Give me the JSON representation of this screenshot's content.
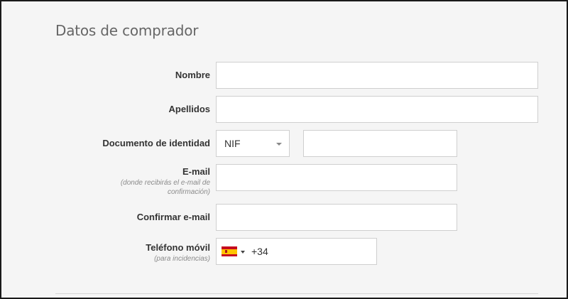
{
  "section": {
    "title": "Datos de comprador"
  },
  "fields": {
    "nombre": {
      "label": "Nombre",
      "value": ""
    },
    "apellidos": {
      "label": "Apellidos",
      "value": ""
    },
    "documento": {
      "label": "Documento de identidad",
      "type_selected": "NIF",
      "value": ""
    },
    "email": {
      "label": "E-mail",
      "hint_line1": "(donde recibirás el e-mail de",
      "hint_line2": "confirmación)",
      "value": ""
    },
    "confirmar_email": {
      "label": "Confirmar e-mail",
      "value": ""
    },
    "telefono": {
      "label": "Teléfono móvil",
      "hint": "(para incidencias)",
      "country_flag": "spain-flag-icon",
      "dial_code": "+34"
    }
  },
  "colors": {
    "background": "#f5f5f5",
    "input_border": "#cfcfcf",
    "label": "#333333",
    "hint": "#8a8a8a",
    "title": "#666666"
  }
}
